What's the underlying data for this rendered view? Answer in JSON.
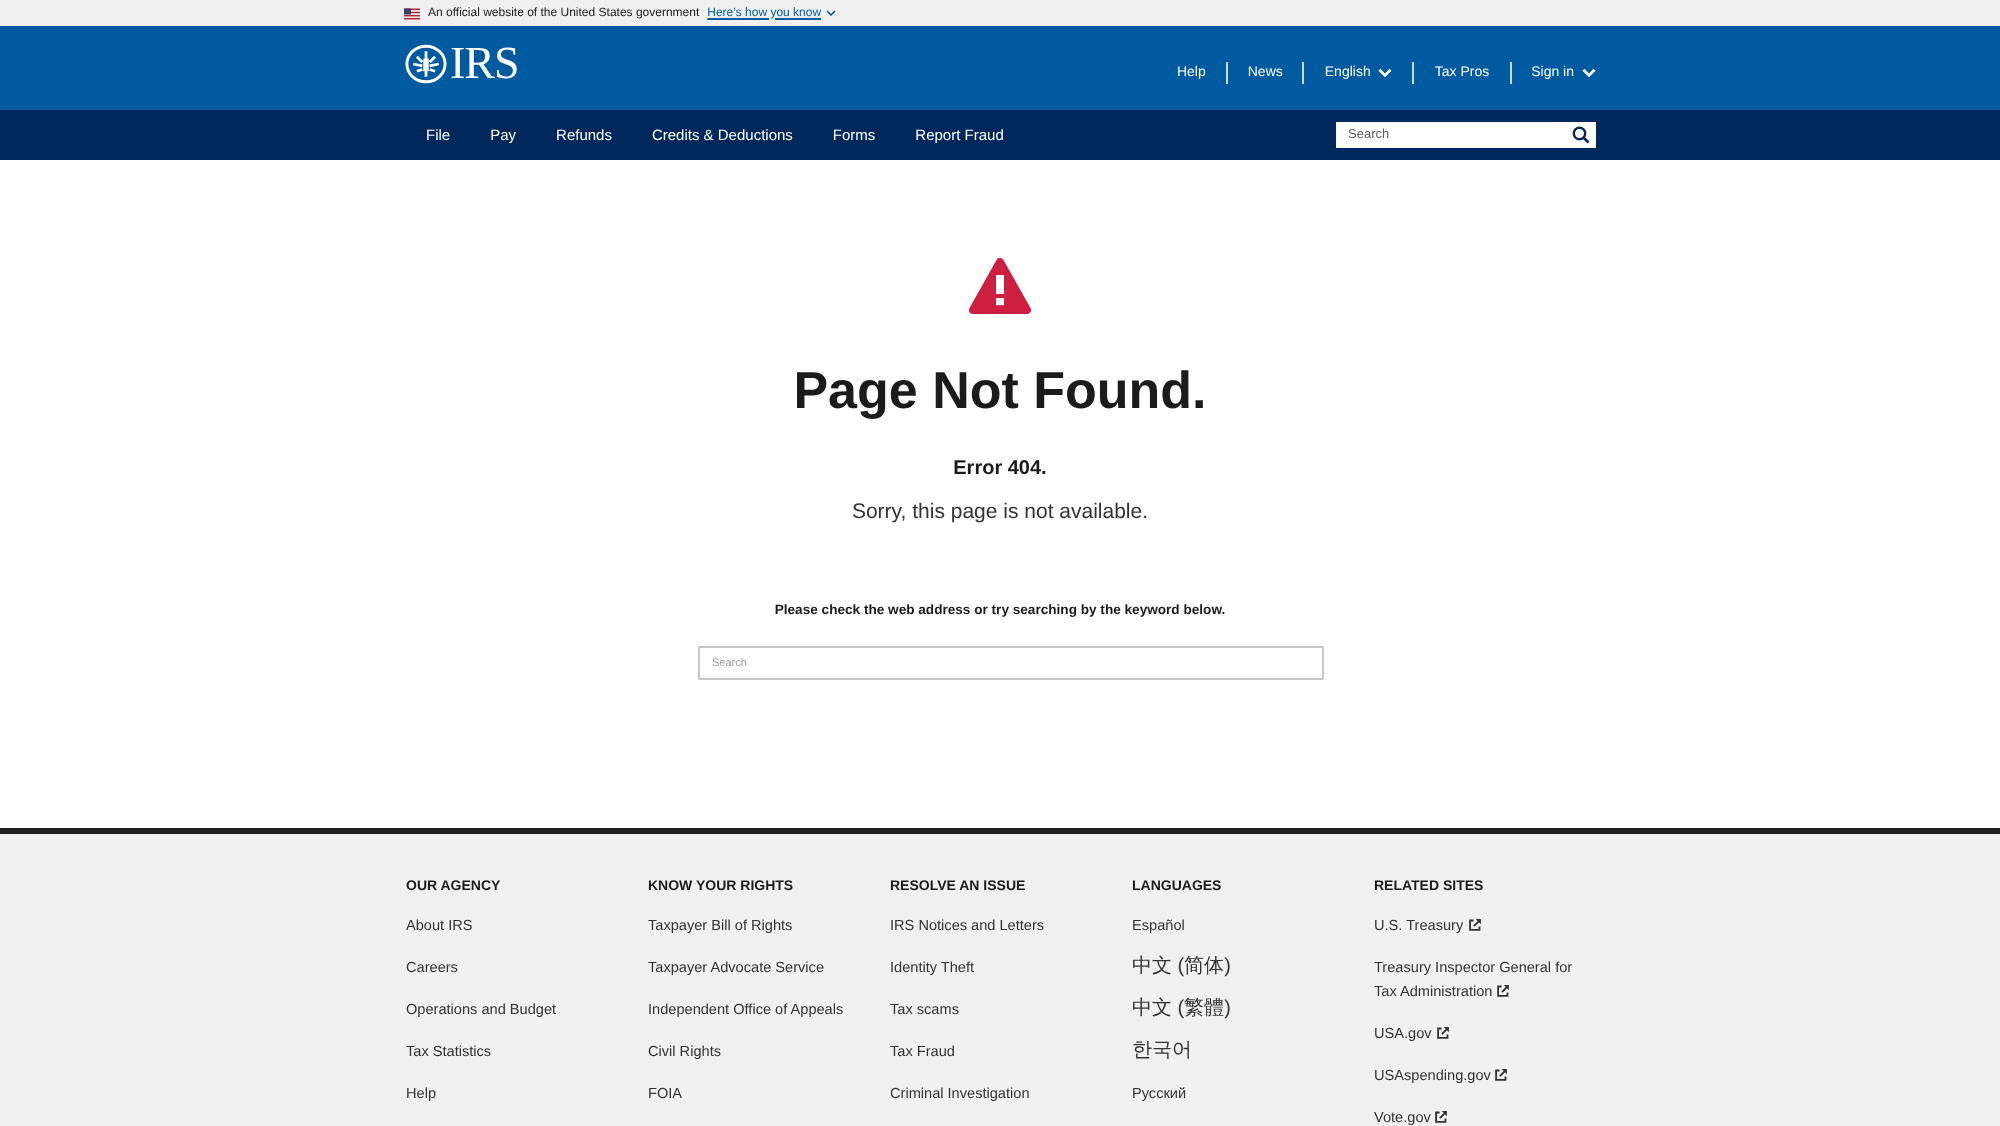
{
  "gov_banner": {
    "text": "An official website of the United States government",
    "link": "Here’s how you know"
  },
  "header": {
    "logo": "IRS",
    "links": [
      {
        "label": "Help",
        "dropdown": false
      },
      {
        "label": "News",
        "dropdown": false
      },
      {
        "label": "English",
        "dropdown": true
      },
      {
        "label": "Tax Pros",
        "dropdown": false
      },
      {
        "label": "Sign in",
        "dropdown": true
      }
    ]
  },
  "nav": {
    "items": [
      "File",
      "Pay",
      "Refunds",
      "Credits & Deductions",
      "Forms",
      "Report Fraud"
    ],
    "search": {
      "placeholder": "Search"
    }
  },
  "error_page": {
    "title": "Page Not Found.",
    "code": "Error 404.",
    "message": "Sorry, this page is not available.",
    "hint": "Please check the web address or try searching by the keyword below.",
    "search": {
      "placeholder": "Search"
    }
  },
  "footer": {
    "columns": [
      {
        "heading": "OUR AGENCY",
        "links": [
          {
            "label": "About IRS",
            "external": false
          },
          {
            "label": "Careers",
            "external": false
          },
          {
            "label": "Operations and Budget",
            "external": false
          },
          {
            "label": "Tax Statistics",
            "external": false
          },
          {
            "label": "Help",
            "external": false
          }
        ]
      },
      {
        "heading": "KNOW YOUR RIGHTS",
        "links": [
          {
            "label": "Taxpayer Bill of Rights",
            "external": false
          },
          {
            "label": "Taxpayer Advocate Service",
            "external": false
          },
          {
            "label": "Independent Office of Appeals",
            "external": false
          },
          {
            "label": "Civil Rights",
            "external": false
          },
          {
            "label": "FOIA",
            "external": false
          }
        ]
      },
      {
        "heading": "RESOLVE AN ISSUE",
        "links": [
          {
            "label": "IRS Notices and Letters",
            "external": false
          },
          {
            "label": "Identity Theft",
            "external": false
          },
          {
            "label": "Tax scams",
            "external": false
          },
          {
            "label": "Tax Fraud",
            "external": false
          },
          {
            "label": "Criminal Investigation",
            "external": false
          }
        ]
      },
      {
        "heading": "LANGUAGES",
        "links": [
          {
            "label": "Español",
            "external": false
          },
          {
            "label": "中文 (简体)",
            "external": false
          },
          {
            "label": "中文 (繁體)",
            "external": false
          },
          {
            "label": "한국어",
            "external": false
          },
          {
            "label": "Русский",
            "external": false
          }
        ]
      },
      {
        "heading": "RELATED SITES",
        "links": [
          {
            "label": "U.S. Treasury",
            "external": true
          },
          {
            "label": "Treasury Inspector General for Tax Administration",
            "external": true
          },
          {
            "label": "USA.gov",
            "external": true
          },
          {
            "label": "USAspending.gov",
            "external": true
          },
          {
            "label": "Vote.gov",
            "external": true
          }
        ]
      }
    ]
  }
}
